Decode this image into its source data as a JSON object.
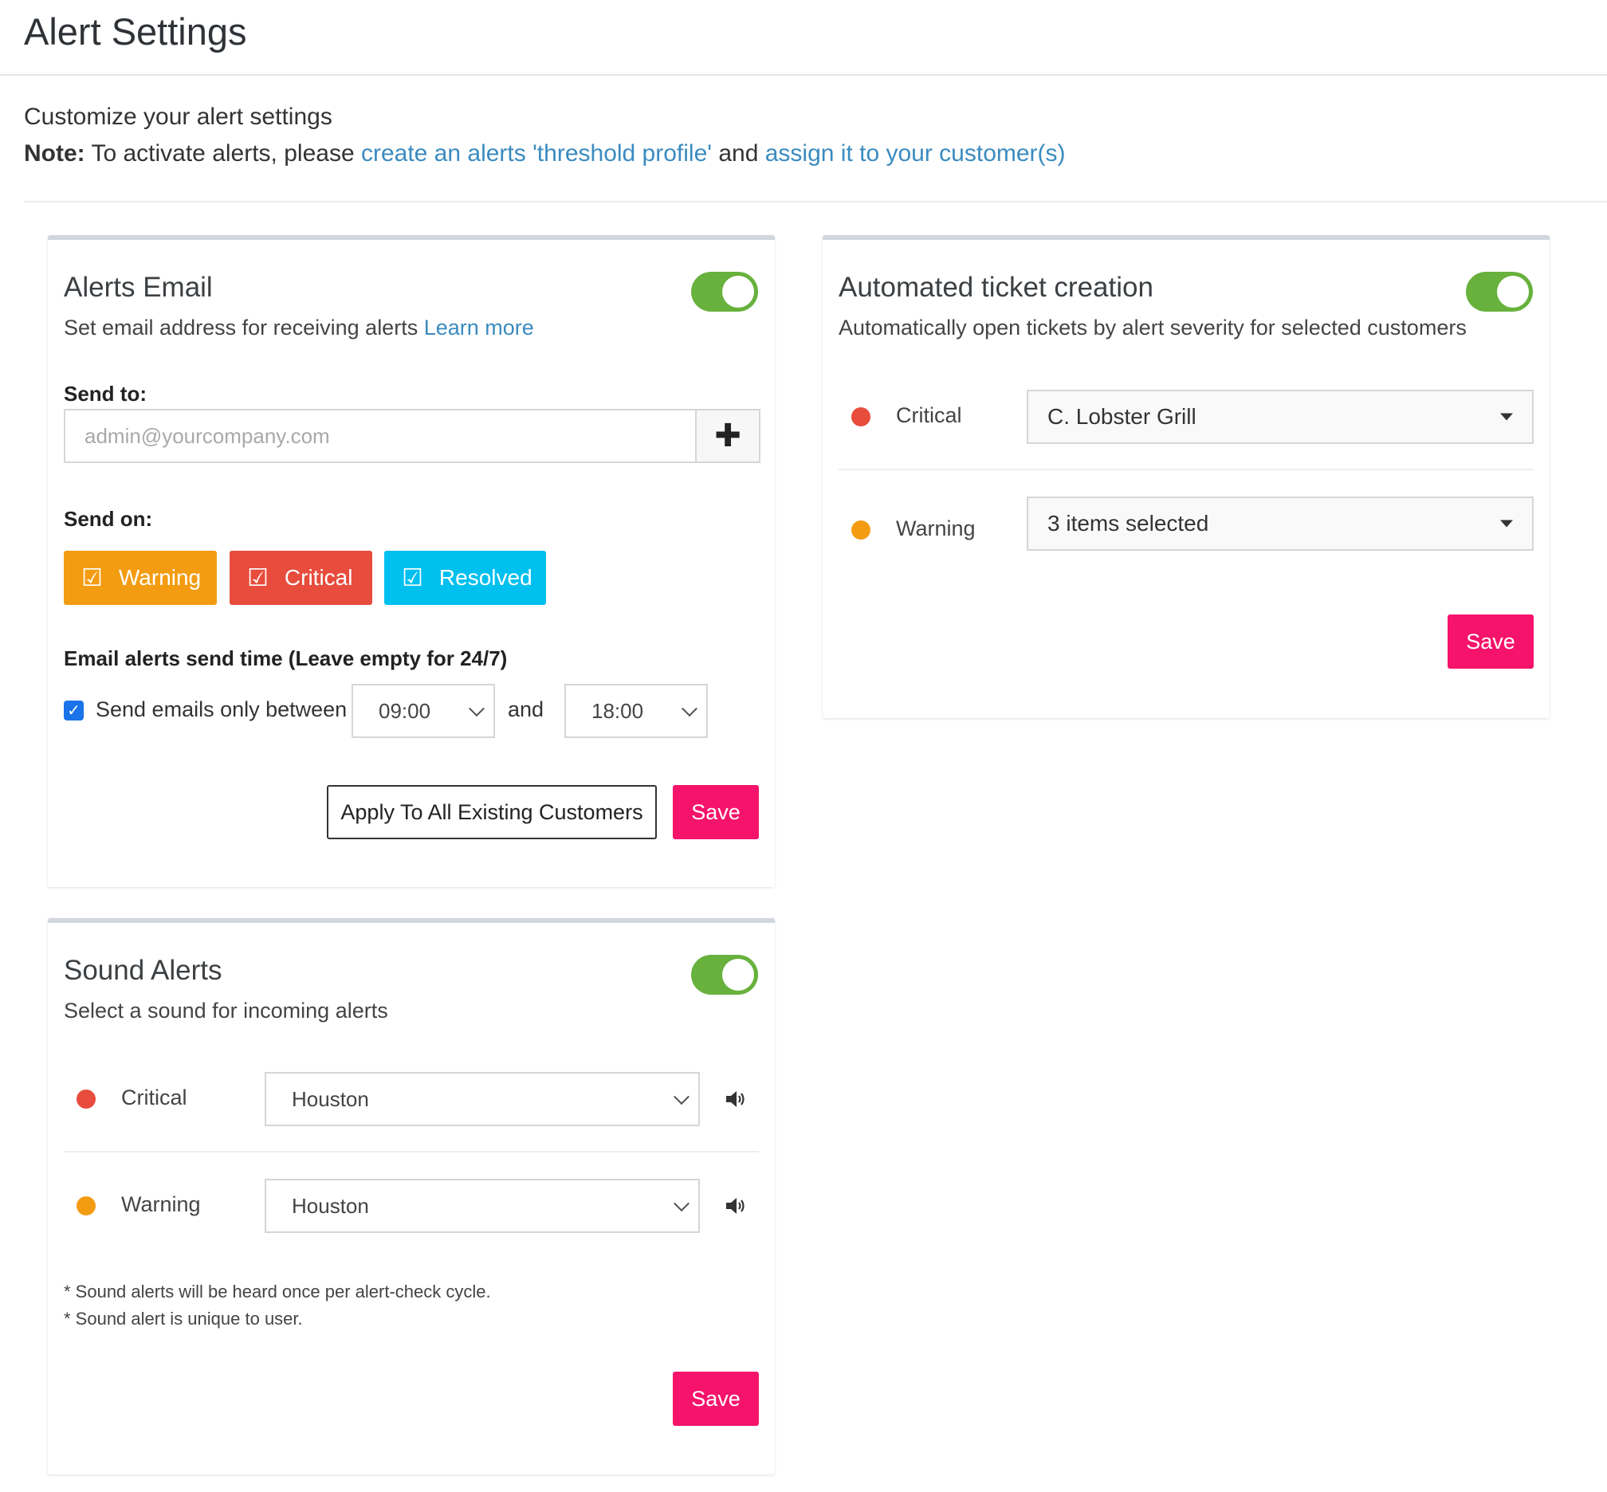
{
  "page": {
    "title": "Alert Settings"
  },
  "intro": {
    "line1": "Customize your alert settings",
    "note_label": "Note:",
    "note_text": " To activate alerts, please ",
    "link1": "create an alerts 'threshold profile'",
    "and_text": " and ",
    "link2": "assign it to your customer(s)"
  },
  "colors": {
    "warning": "#f39c12",
    "critical": "#e74c3c",
    "resolved": "#00c0ef",
    "save": "#f5136b",
    "toggle_on": "#67b13c",
    "link": "#3a8bbf"
  },
  "alerts_email": {
    "title": "Alerts Email",
    "subtitle": "Set email address for receiving alerts ",
    "learn_more": "Learn more",
    "enabled": true,
    "send_to_label": "Send to:",
    "email_placeholder": "admin@yourcompany.com",
    "add_icon": "plus-icon",
    "send_on_label": "Send on:",
    "severities": [
      {
        "label": "Warning",
        "checked": true
      },
      {
        "label": "Critical",
        "checked": true
      },
      {
        "label": "Resolved",
        "checked": true
      }
    ],
    "send_time_label": "Email alerts send time (Leave empty for 24/7)",
    "between_checkbox_checked": true,
    "between_label": "Send emails only between",
    "start_time": "09:00",
    "and_label": "and",
    "end_time": "18:00",
    "apply_all_label": "Apply To All Existing Customers",
    "save_label": "Save"
  },
  "sound_alerts": {
    "title": "Sound Alerts",
    "subtitle": "Select a sound for incoming alerts",
    "enabled": true,
    "rows": [
      {
        "label": "Critical",
        "sound": "Houston",
        "icon": "speaker-icon"
      },
      {
        "label": "Warning",
        "sound": "Houston",
        "icon": "speaker-icon"
      }
    ],
    "footnote1": "* Sound alerts will be heard once per alert-check cycle.",
    "footnote2": "* Sound alert is unique to user.",
    "save_label": "Save"
  },
  "ticket_creation": {
    "title": "Automated ticket creation",
    "subtitle": "Automatically open tickets by alert severity for selected customers",
    "enabled": true,
    "rows": [
      {
        "label": "Critical",
        "value": "C. Lobster Grill"
      },
      {
        "label": "Warning",
        "value": "3 items selected"
      }
    ],
    "save_label": "Save"
  }
}
